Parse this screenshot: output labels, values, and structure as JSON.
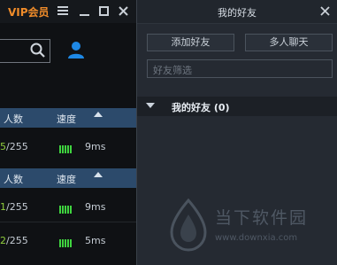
{
  "left_panel": {
    "vip_label": "VIP会员",
    "tables": [
      {
        "header": {
          "count_col": "人数",
          "speed_col": "速度"
        },
        "rows": [
          {
            "count_highlight": "5",
            "count_rest": "/255",
            "speed": "9ms"
          }
        ]
      },
      {
        "header": {
          "count_col": "人数",
          "speed_col": "速度"
        },
        "rows": [
          {
            "count_highlight": "1",
            "count_rest": "/255",
            "speed": "9ms"
          },
          {
            "count_highlight": "2",
            "count_rest": "/255",
            "speed": "5ms"
          }
        ]
      }
    ]
  },
  "friends_panel": {
    "title": "我的好友",
    "add_friend_label": "添加好友",
    "group_chat_label": "多人聊天",
    "filter_placeholder": "好友筛选",
    "group": {
      "name": "我的好友 (0)"
    }
  },
  "watermark": {
    "name": "当下软件园",
    "url": "www.downxia.com"
  },
  "colors": {
    "vip": "#f08c2a",
    "signal": "#3fd33f",
    "user_icon": "#1e88e5",
    "header_bg": "#2c4a6b"
  }
}
